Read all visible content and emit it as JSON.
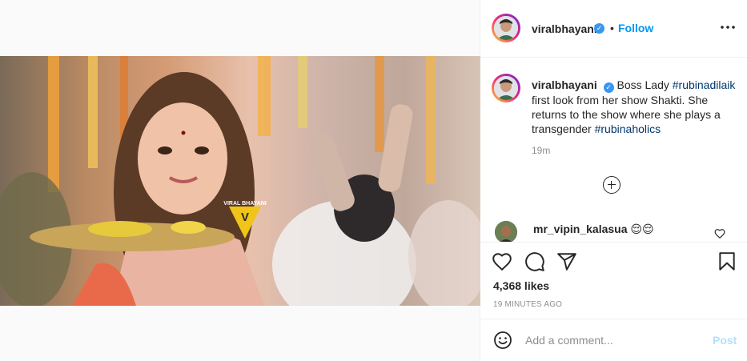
{
  "post": {
    "username": "viralbhayani",
    "verified_mark": "✓",
    "separator": "•",
    "follow_label": "Follow",
    "more_icon": "more-horizontal-icon"
  },
  "media": {
    "watermark": "VIRAL BHAYANI",
    "watermark_mark": "V"
  },
  "caption": {
    "username": "viralbhayani",
    "segments": [
      {
        "text": "Boss Lady ",
        "type": "text"
      },
      {
        "text": "#rubinadilaik",
        "type": "hashtag"
      },
      {
        "text": " first look from her show Shakti. She returns to the show where she plays a transgender ",
        "type": "text"
      },
      {
        "text": "#rubinaholics",
        "type": "hashtag"
      }
    ],
    "time": "19m"
  },
  "comment": {
    "username": "mr_vipin_kalasua",
    "text": "😌😌"
  },
  "actions": {
    "likes": "4,368 likes",
    "timestamp": "19 MINUTES AGO"
  },
  "add_comment": {
    "placeholder": "Add a comment...",
    "post_label": "Post"
  },
  "colors": {
    "link": "#0095f6",
    "hashtag": "#00376b",
    "muted": "#8e8e8e",
    "post_disabled": "#b2dffc"
  }
}
